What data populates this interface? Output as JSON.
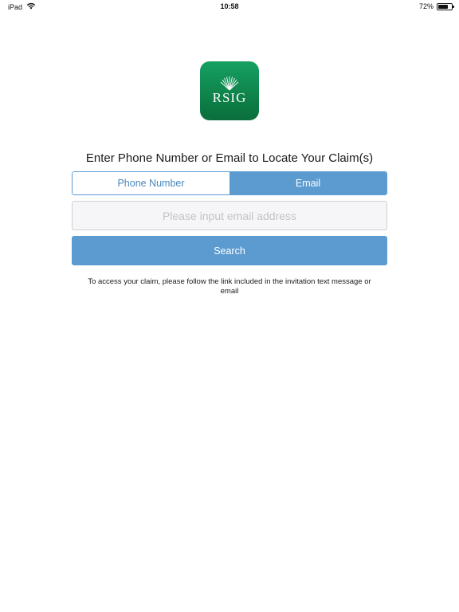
{
  "status_bar": {
    "device": "iPad",
    "time": "10:58",
    "battery_percent": "72%",
    "battery_level": 0.72,
    "icons": [
      "wifi-icon",
      "battery-icon"
    ]
  },
  "logo": {
    "text": "RSIG",
    "color": "#0e8249"
  },
  "prompt": "Enter Phone Number or Email to Locate Your Claim(s)",
  "tabs": {
    "phone_label": "Phone Number",
    "email_label": "Email",
    "selected": "Email"
  },
  "email_input": {
    "placeholder": "Please input email address",
    "value": ""
  },
  "search_button": {
    "label": "Search"
  },
  "help_text": "To access your claim, please follow the link included in the invitation text message or email",
  "colors": {
    "accent": "#5b9bd0",
    "accent_text": "#4a86be",
    "input_bg": "#f6f6f8",
    "placeholder": "#c3c3c8"
  }
}
